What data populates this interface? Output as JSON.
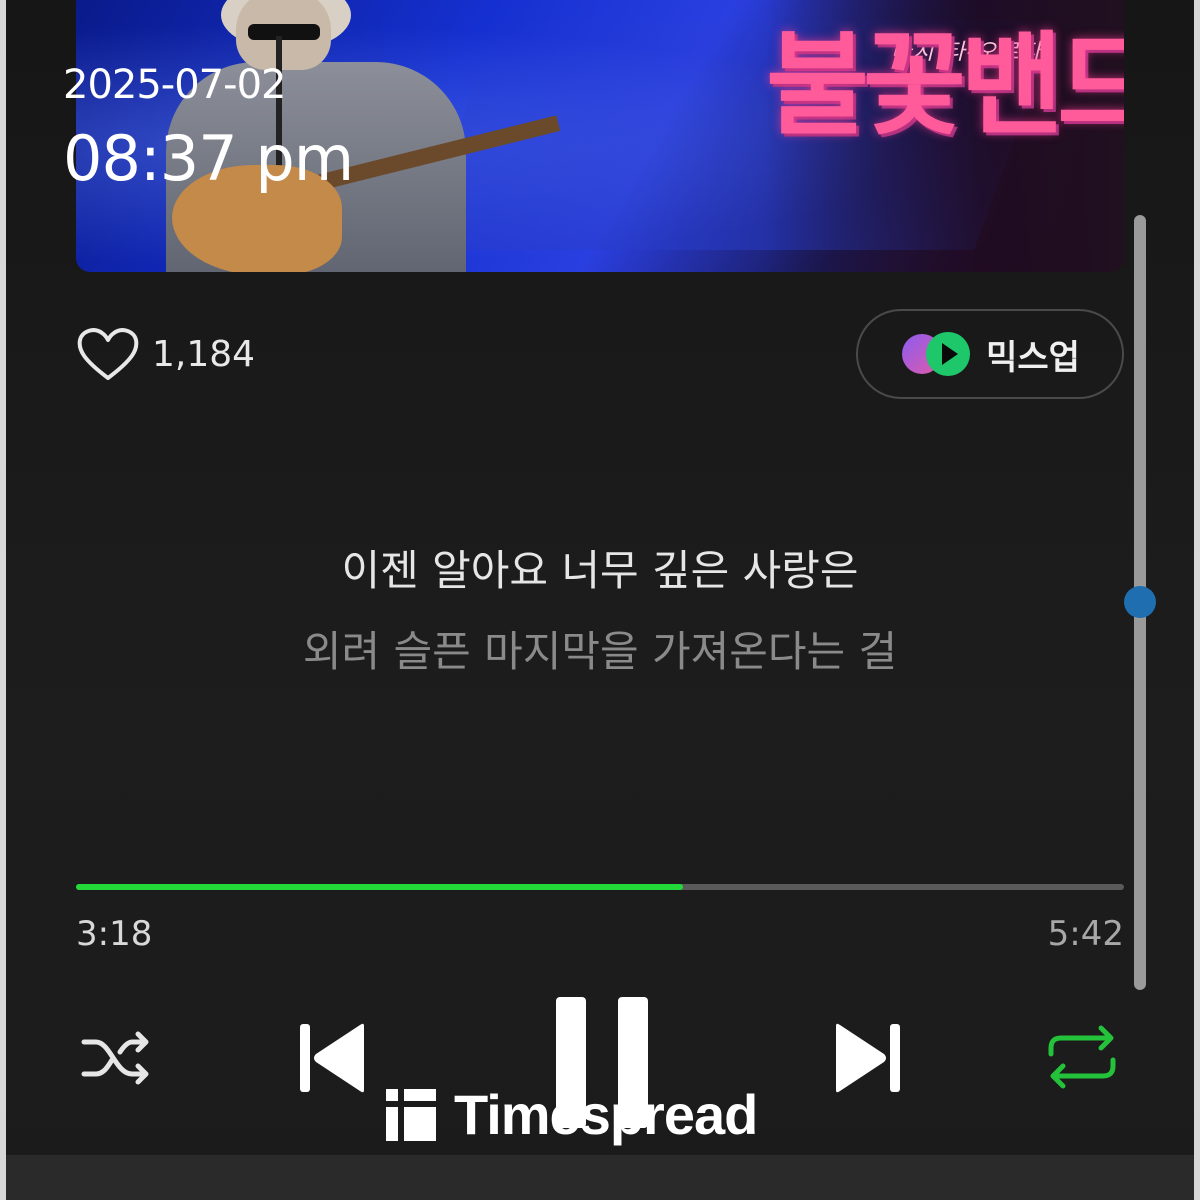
{
  "overlay": {
    "date": "2025-07-02",
    "time": "08:37 pm"
  },
  "album_art": {
    "title": "불꽃밴드",
    "subtitle": "다시 타-오르다"
  },
  "like": {
    "count": "1,184",
    "icon": "heart-icon"
  },
  "mixup": {
    "label": "믹스업",
    "icon": "mixup-icon"
  },
  "lyrics": {
    "current": "이젠 알아요 너무 깊은 사랑은",
    "next": "외려 슬픈 마지막을 가져온다는 걸"
  },
  "playback": {
    "elapsed": "3:18",
    "total": "5:42",
    "progress_fraction": 0.5789,
    "progress_color": "#23d93a"
  },
  "controls": {
    "shuffle_icon": "shuffle-icon",
    "prev_icon": "skip-previous-icon",
    "pause_icon": "pause-icon",
    "next_icon": "skip-next-icon",
    "repeat_icon": "repeat-icon",
    "repeat_active_color": "#23c23a"
  },
  "watermark": {
    "text": "Timespread"
  }
}
